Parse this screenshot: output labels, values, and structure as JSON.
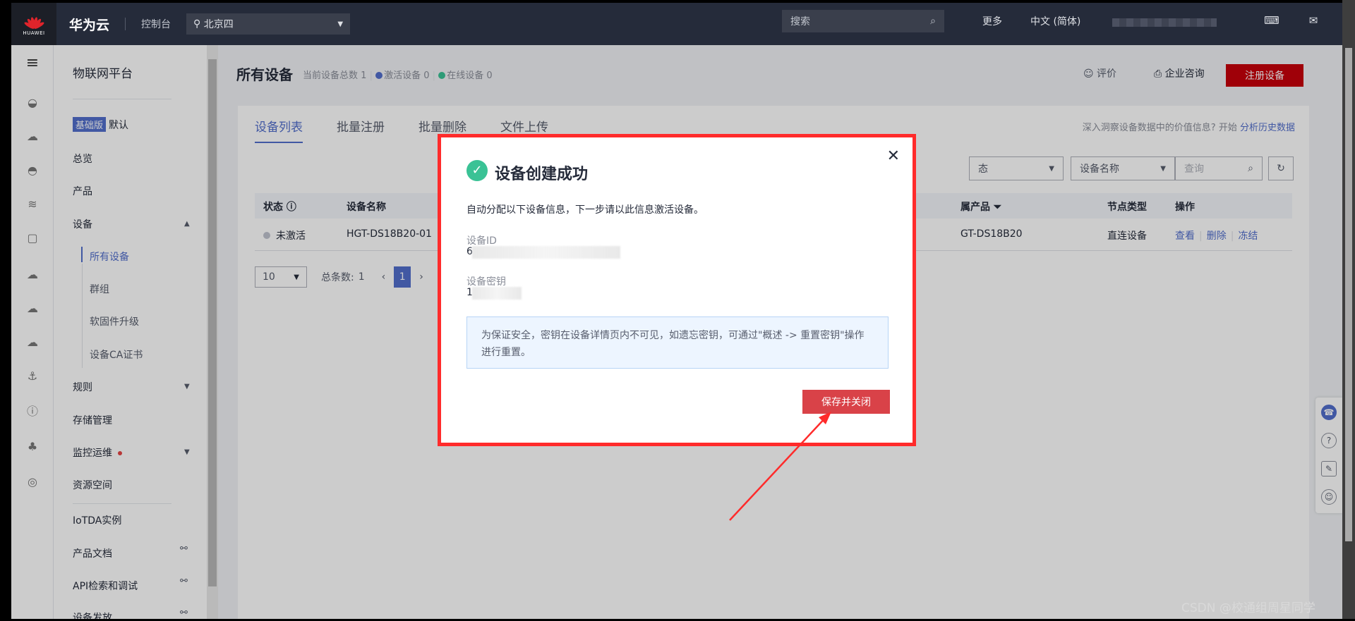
{
  "topbar": {
    "brand": "HUAWEI",
    "cloud_name": "华为云",
    "console": "控制台",
    "region": "北京四",
    "search_placeholder": "搜索",
    "more": "更多",
    "language": "中文 (简体)"
  },
  "sidebar": {
    "title": "物联网平台",
    "edition_badge": "基础版",
    "edition_default": "默认",
    "overview": "总览",
    "product": "产品",
    "device": "设备",
    "device_sub": [
      "所有设备",
      "群组",
      "软固件升级",
      "设备CA证书"
    ],
    "rules": "规则",
    "storage": "存储管理",
    "monitor": "监控运维",
    "resource_space": "资源空间",
    "iotda_instance": "IoTDA实例",
    "product_docs": "产品文档",
    "api_debug": "API检索和调试",
    "device_dev": "设备发放"
  },
  "header": {
    "title": "所有设备",
    "total_label": "当前设备总数",
    "total": "1",
    "activated_label": "激活设备",
    "activated": "0",
    "online_label": "在线设备",
    "online": "0",
    "rate": "评价",
    "consult": "企业咨询",
    "register_button": "注册设备"
  },
  "tabs": [
    "设备列表",
    "批量注册",
    "批量删除",
    "文件上传"
  ],
  "insight": {
    "text": "深入洞察设备数据中的价值信息? 开始",
    "link": "分析历史数据"
  },
  "filters": {
    "status_partial": "态",
    "name_select": "设备名称",
    "query_placeholder": "查询"
  },
  "table": {
    "headers": [
      "状态",
      "设备名称",
      "属产品",
      "节点类型",
      "操作"
    ],
    "row": {
      "status": "未激活",
      "name": "HGT-DS18B20-01",
      "product": "GT-DS18B20",
      "node_type": "直连设备",
      "ops": [
        "查看",
        "删除",
        "冻结"
      ]
    }
  },
  "pager": {
    "page_size": "10",
    "total_label": "总条数:",
    "total": "1",
    "current_page": "1"
  },
  "modal": {
    "title": "设备创建成功",
    "desc": "自动分配以下设备信息，下一步请以此信息激活设备。",
    "device_id_label": "设备ID",
    "device_id_value": "6",
    "secret_label": "设备密钥",
    "secret_value": "1",
    "notice": "为保证安全，密钥在设备详情页内不可见，如遗忘密钥，可通过\"概述 -> 重置密钥\"操作进行重置。",
    "save_button": "保存并关闭"
  },
  "watermark": "CSDN @校通组周星同学",
  "colors": {
    "brand_red": "#c7000b",
    "primary_blue": "#526ecc",
    "success_green": "#3ac295",
    "highlight_frame": "#ff2b2b",
    "activated_dot": "#526ecc",
    "online_dot": "#3ac295"
  }
}
